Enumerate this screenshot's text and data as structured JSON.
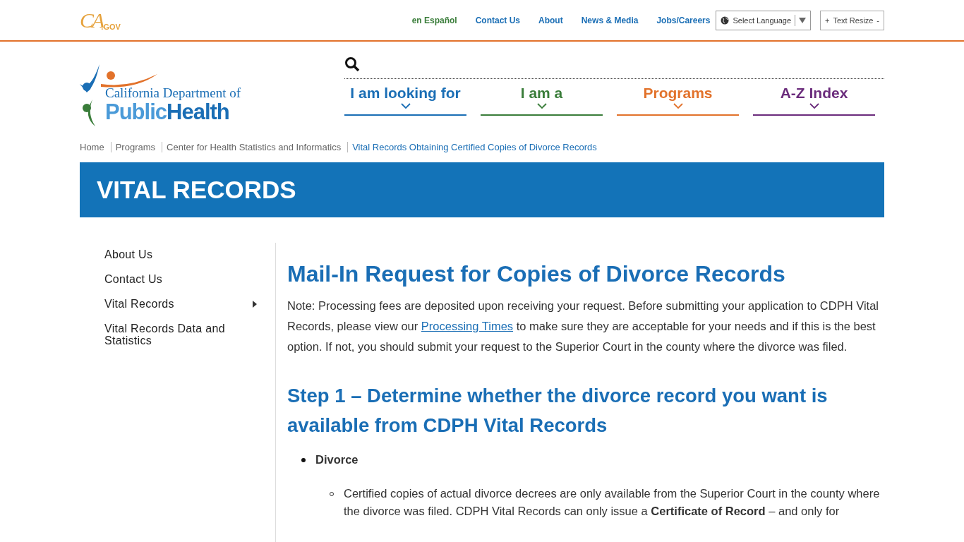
{
  "top_bar": {
    "logo": {
      "mark": "CA",
      "suffix": ".GOV"
    },
    "links": [
      {
        "label": "en Español",
        "kind": "language"
      },
      {
        "label": "Contact Us",
        "kind": "link"
      },
      {
        "label": "About",
        "kind": "link"
      },
      {
        "label": "News & Media",
        "kind": "link"
      },
      {
        "label": "Jobs/Careers",
        "kind": "link"
      }
    ],
    "language_select": {
      "label": "Select Language"
    },
    "text_resize": {
      "plus": "+",
      "label": "Text Resize",
      "minus": "-"
    }
  },
  "header": {
    "logo": {
      "line1": "California Department of",
      "public": "Public",
      "health": "Health"
    },
    "nav": [
      {
        "label": "I am looking for",
        "color": "#1a6eb5"
      },
      {
        "label": "I am a",
        "color": "#3a7d3a"
      },
      {
        "label": "Programs",
        "color": "#e2722b"
      },
      {
        "label": "A-Z Index",
        "color": "#6b2c7c"
      }
    ]
  },
  "breadcrumb": [
    {
      "label": "Home",
      "current": false
    },
    {
      "label": "Programs",
      "current": false
    },
    {
      "label": "Center for Health Statistics and Informatics",
      "current": false
    },
    {
      "label": "Vital Records Obtaining Certified Copies of Divorce Records",
      "current": true
    }
  ],
  "banner": {
    "title": "VITAL RECORDS"
  },
  "sidebar": {
    "items": [
      {
        "label": "About Us",
        "has_children": false
      },
      {
        "label": "Contact Us",
        "has_children": false
      },
      {
        "label": "Vital Records",
        "has_children": true
      },
      {
        "label": "Vital Records Data and Statistics",
        "has_children": false
      }
    ]
  },
  "content": {
    "title": "Mail-In Request for Copies of Divorce Records",
    "note": {
      "before": "Note: Processing fees are deposited upon receiving your request. Before submitting your application to CDPH Vital Records, please view our ",
      "link": "Processing Times",
      "after": " to make sure they are acceptable for your needs and if this is the best option. If not, you should submit your request to the Superior Court in the county where the divorce was filed."
    },
    "step_heading": "Step 1 – Determine whether the divorce record you want is available from CDPH Vital Records",
    "bullets": [
      {
        "label": "Divorce",
        "children": [
          {
            "label": "Certified copies of actual divorce decrees are only available from the Superior Court in the county where the divorce was filed. CDPH Vital Records can only issue a **Certificate of Record** – and only for"
          }
        ]
      }
    ]
  }
}
